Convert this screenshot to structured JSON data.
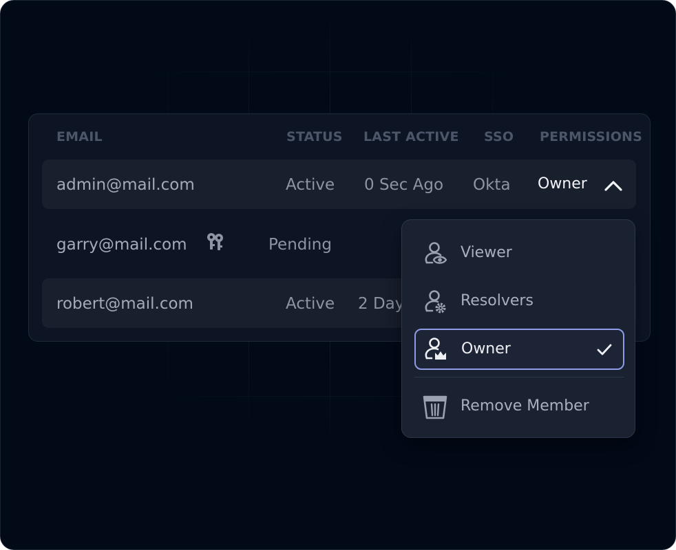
{
  "table": {
    "headers": {
      "email": "EMAIL",
      "status": "STATUS",
      "last_active": "LAST ACTIVE",
      "sso": "SSO",
      "permissions": "PERMISSIONS"
    },
    "rows": [
      {
        "email": "admin@mail.com",
        "status": "Active",
        "last_active": "0 Sec Ago",
        "sso": "Okta",
        "permission": "Owner"
      },
      {
        "email": "garry@mail.com",
        "status": "Pending",
        "icon": "keys-icon"
      },
      {
        "email": "robert@mail.com",
        "status": "Active",
        "last_active": "2 Day"
      }
    ]
  },
  "dropdown": {
    "items": [
      {
        "label": "Viewer",
        "icon": "user-eye-icon"
      },
      {
        "label": "Resolvers",
        "icon": "user-gear-icon"
      },
      {
        "label": "Owner",
        "icon": "user-crown-icon",
        "selected": true
      },
      {
        "label": "Remove Member",
        "icon": "trash-icon"
      }
    ]
  },
  "colors": {
    "background": "#020a18",
    "card": "#0d1525",
    "row_highlight": "#181f2d",
    "dropdown": "#1a2130",
    "selected_border": "#8f9ce6",
    "header_text": "#4d5669",
    "cell_text": "#8d94a3"
  }
}
